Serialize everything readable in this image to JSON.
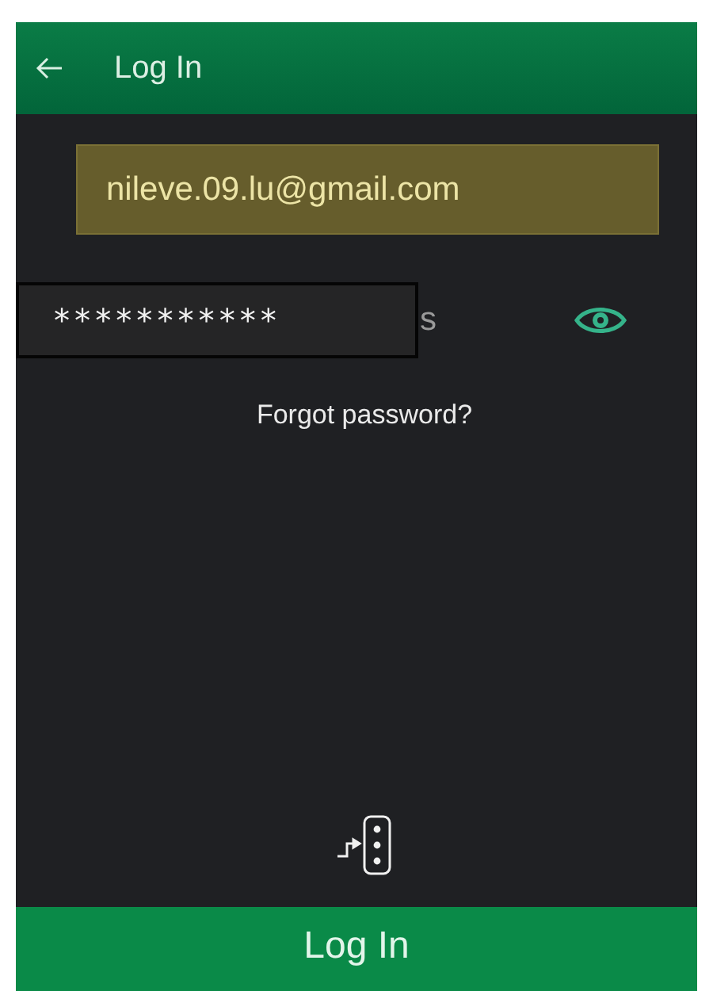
{
  "header": {
    "title": "Log In"
  },
  "email": {
    "value": "nileve.09.lu@gmail.com"
  },
  "password": {
    "masked": "***********",
    "visible_tail": "s",
    "show_password": true
  },
  "forgot_link": "Forgot password?",
  "submit": {
    "label": "Log In"
  }
}
